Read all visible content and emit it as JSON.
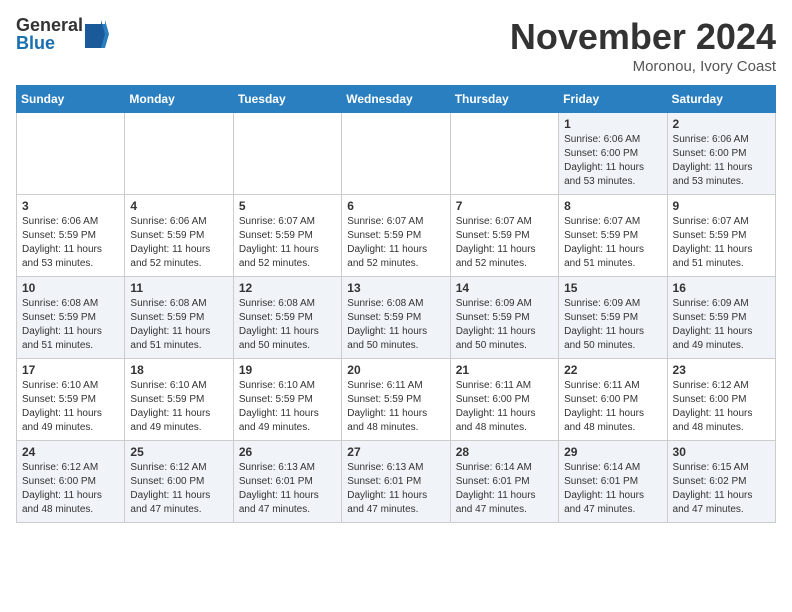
{
  "logo": {
    "general": "General",
    "blue": "Blue"
  },
  "title": "November 2024",
  "location": "Moronou, Ivory Coast",
  "days_of_week": [
    "Sunday",
    "Monday",
    "Tuesday",
    "Wednesday",
    "Thursday",
    "Friday",
    "Saturday"
  ],
  "weeks": [
    [
      {
        "day": "",
        "info": ""
      },
      {
        "day": "",
        "info": ""
      },
      {
        "day": "",
        "info": ""
      },
      {
        "day": "",
        "info": ""
      },
      {
        "day": "",
        "info": ""
      },
      {
        "day": "1",
        "info": "Sunrise: 6:06 AM\nSunset: 6:00 PM\nDaylight: 11 hours and 53 minutes."
      },
      {
        "day": "2",
        "info": "Sunrise: 6:06 AM\nSunset: 6:00 PM\nDaylight: 11 hours and 53 minutes."
      }
    ],
    [
      {
        "day": "3",
        "info": "Sunrise: 6:06 AM\nSunset: 5:59 PM\nDaylight: 11 hours and 53 minutes."
      },
      {
        "day": "4",
        "info": "Sunrise: 6:06 AM\nSunset: 5:59 PM\nDaylight: 11 hours and 52 minutes."
      },
      {
        "day": "5",
        "info": "Sunrise: 6:07 AM\nSunset: 5:59 PM\nDaylight: 11 hours and 52 minutes."
      },
      {
        "day": "6",
        "info": "Sunrise: 6:07 AM\nSunset: 5:59 PM\nDaylight: 11 hours and 52 minutes."
      },
      {
        "day": "7",
        "info": "Sunrise: 6:07 AM\nSunset: 5:59 PM\nDaylight: 11 hours and 52 minutes."
      },
      {
        "day": "8",
        "info": "Sunrise: 6:07 AM\nSunset: 5:59 PM\nDaylight: 11 hours and 51 minutes."
      },
      {
        "day": "9",
        "info": "Sunrise: 6:07 AM\nSunset: 5:59 PM\nDaylight: 11 hours and 51 minutes."
      }
    ],
    [
      {
        "day": "10",
        "info": "Sunrise: 6:08 AM\nSunset: 5:59 PM\nDaylight: 11 hours and 51 minutes."
      },
      {
        "day": "11",
        "info": "Sunrise: 6:08 AM\nSunset: 5:59 PM\nDaylight: 11 hours and 51 minutes."
      },
      {
        "day": "12",
        "info": "Sunrise: 6:08 AM\nSunset: 5:59 PM\nDaylight: 11 hours and 50 minutes."
      },
      {
        "day": "13",
        "info": "Sunrise: 6:08 AM\nSunset: 5:59 PM\nDaylight: 11 hours and 50 minutes."
      },
      {
        "day": "14",
        "info": "Sunrise: 6:09 AM\nSunset: 5:59 PM\nDaylight: 11 hours and 50 minutes."
      },
      {
        "day": "15",
        "info": "Sunrise: 6:09 AM\nSunset: 5:59 PM\nDaylight: 11 hours and 50 minutes."
      },
      {
        "day": "16",
        "info": "Sunrise: 6:09 AM\nSunset: 5:59 PM\nDaylight: 11 hours and 49 minutes."
      }
    ],
    [
      {
        "day": "17",
        "info": "Sunrise: 6:10 AM\nSunset: 5:59 PM\nDaylight: 11 hours and 49 minutes."
      },
      {
        "day": "18",
        "info": "Sunrise: 6:10 AM\nSunset: 5:59 PM\nDaylight: 11 hours and 49 minutes."
      },
      {
        "day": "19",
        "info": "Sunrise: 6:10 AM\nSunset: 5:59 PM\nDaylight: 11 hours and 49 minutes."
      },
      {
        "day": "20",
        "info": "Sunrise: 6:11 AM\nSunset: 5:59 PM\nDaylight: 11 hours and 48 minutes."
      },
      {
        "day": "21",
        "info": "Sunrise: 6:11 AM\nSunset: 6:00 PM\nDaylight: 11 hours and 48 minutes."
      },
      {
        "day": "22",
        "info": "Sunrise: 6:11 AM\nSunset: 6:00 PM\nDaylight: 11 hours and 48 minutes."
      },
      {
        "day": "23",
        "info": "Sunrise: 6:12 AM\nSunset: 6:00 PM\nDaylight: 11 hours and 48 minutes."
      }
    ],
    [
      {
        "day": "24",
        "info": "Sunrise: 6:12 AM\nSunset: 6:00 PM\nDaylight: 11 hours and 48 minutes."
      },
      {
        "day": "25",
        "info": "Sunrise: 6:12 AM\nSunset: 6:00 PM\nDaylight: 11 hours and 47 minutes."
      },
      {
        "day": "26",
        "info": "Sunrise: 6:13 AM\nSunset: 6:01 PM\nDaylight: 11 hours and 47 minutes."
      },
      {
        "day": "27",
        "info": "Sunrise: 6:13 AM\nSunset: 6:01 PM\nDaylight: 11 hours and 47 minutes."
      },
      {
        "day": "28",
        "info": "Sunrise: 6:14 AM\nSunset: 6:01 PM\nDaylight: 11 hours and 47 minutes."
      },
      {
        "day": "29",
        "info": "Sunrise: 6:14 AM\nSunset: 6:01 PM\nDaylight: 11 hours and 47 minutes."
      },
      {
        "day": "30",
        "info": "Sunrise: 6:15 AM\nSunset: 6:02 PM\nDaylight: 11 hours and 47 minutes."
      }
    ]
  ]
}
